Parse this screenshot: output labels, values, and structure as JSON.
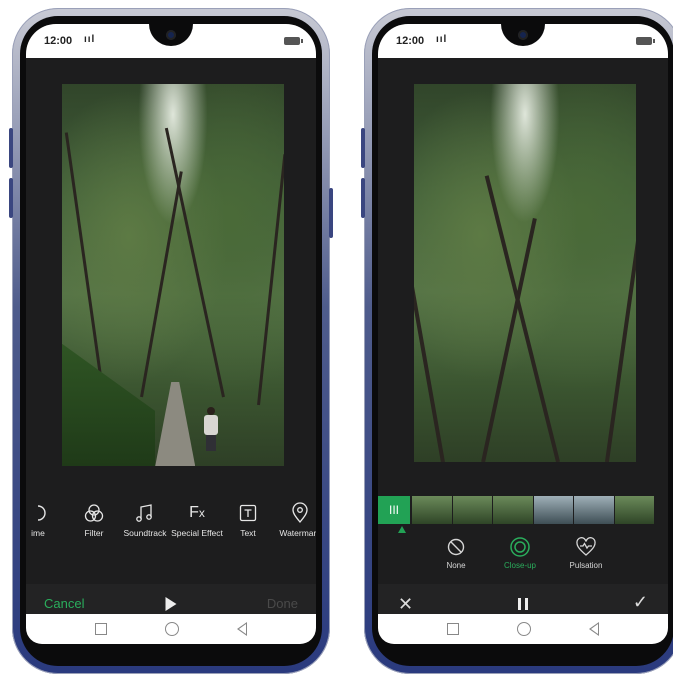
{
  "status": {
    "time": "12:00",
    "signal": "ııl"
  },
  "left_phone": {
    "tools": [
      {
        "label": "ime",
        "icon": "partial-icon"
      },
      {
        "label": "Filter",
        "icon": "filter-icon"
      },
      {
        "label": "Soundtrack",
        "icon": "music-icon"
      },
      {
        "label": "Special Effect",
        "icon": "fx-icon"
      },
      {
        "label": "Text",
        "icon": "text-icon"
      },
      {
        "label": "Watermark",
        "icon": "location-pin-icon"
      }
    ],
    "cancel_label": "Cancel",
    "done_label": "Done"
  },
  "right_phone": {
    "effects": [
      {
        "label": "None",
        "icon": "none-icon"
      },
      {
        "label": "Close-up",
        "icon": "closeup-icon",
        "active": true
      },
      {
        "label": "Pulsation",
        "icon": "heart-pulse-icon"
      }
    ],
    "handle_label": "III"
  },
  "colors": {
    "accent": "#2aad5c",
    "dark": "#1d1d1e"
  }
}
